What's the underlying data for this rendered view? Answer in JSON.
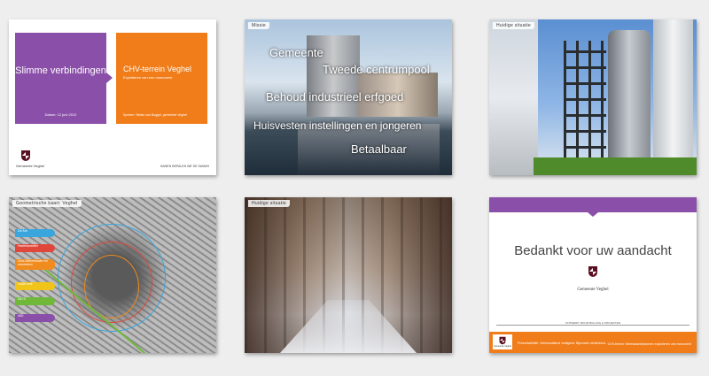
{
  "slides": {
    "s1": {
      "purple_title": "Slimme verbindingen",
      "date": "Datum: 12 juni 2012",
      "orange_title": "CHV-terrein Veghel",
      "orange_subtitle": "Exploiteren van een monument",
      "speaker": "Spreker: Stefan van Boggel, gemeente Veghel",
      "crest_label": "Gemeente Veghel",
      "footer": "SAMEN BEPALEN WE DE SAMAR"
    },
    "s2": {
      "tag": "Missie",
      "lines": [
        "Gemeente",
        "Tweede centrumpool",
        "Behoud industrieel erfgoed",
        "Huisvesten instellingen en jongeren",
        "Betaalbaar"
      ]
    },
    "s3": {
      "tag": "Huidige situatie"
    },
    "s4": {
      "tag": "Geometrische kaart: Veghel",
      "labels": [
        "De Ark",
        "Havenkwartier",
        "Zuid-Willemsvaart en omstreken",
        "Oude kerk",
        "N279",
        "A50"
      ],
      "label_colors": [
        "#3aa6dd",
        "#e0473b",
        "#f08b1e",
        "#f0c419",
        "#6fb83a",
        "#8a4fa8"
      ]
    },
    "s5": {
      "tag": "Huidige situatie"
    },
    "s6": {
      "thanks": "Bedankt voor uw aandacht",
      "gemeente": "Gemeente Veghel",
      "small_line": "ONTWERP: BOUW BOLLING & PROJECTEN",
      "crest_label": "Gemeente Veghel",
      "bottom_left": "Presentatietitel: Veelomvattend vestigend. Bijzonder verbindend.",
      "bottom_right": "CHV-terrein: Meerwaardeplannen exploiteren van monument"
    }
  },
  "colors": {
    "purple": "#8a4fa8",
    "orange": "#f07d1a"
  }
}
